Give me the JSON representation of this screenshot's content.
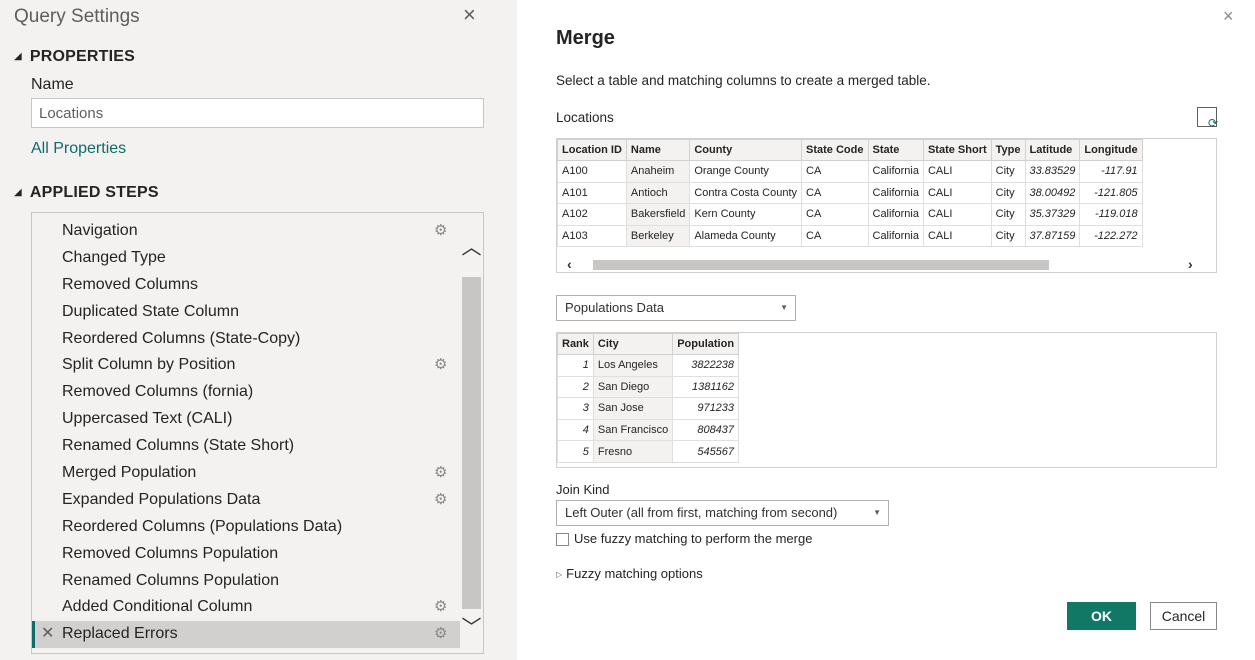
{
  "query_settings": {
    "title": "Query Settings",
    "properties_heading": "PROPERTIES",
    "name_label": "Name",
    "name_value": "Locations",
    "all_properties_link": "All Properties",
    "applied_steps_heading": "APPLIED STEPS",
    "steps": [
      {
        "label": "Navigation",
        "gear": true
      },
      {
        "label": "Changed Type",
        "gear": false
      },
      {
        "label": "Removed Columns",
        "gear": false
      },
      {
        "label": "Duplicated State Column",
        "gear": false
      },
      {
        "label": "Reordered Columns (State-Copy)",
        "gear": false
      },
      {
        "label": "Split Column by Position",
        "gear": true
      },
      {
        "label": "Removed Columns (fornia)",
        "gear": false
      },
      {
        "label": "Uppercased Text (CALI)",
        "gear": false
      },
      {
        "label": "Renamed Columns (State Short)",
        "gear": false
      },
      {
        "label": "Merged Population",
        "gear": true
      },
      {
        "label": "Expanded Populations Data",
        "gear": true
      },
      {
        "label": "Reordered Columns (Populations Data)",
        "gear": false
      },
      {
        "label": "Removed Columns Population",
        "gear": false
      },
      {
        "label": "Renamed Columns Population",
        "gear": false
      },
      {
        "label": "Added Conditional Column",
        "gear": true
      },
      {
        "label": "Replaced Errors",
        "gear": true,
        "active": true
      }
    ]
  },
  "merge": {
    "title": "Merge",
    "description": "Select a table and matching columns to create a merged table.",
    "table1_name": "Locations",
    "table1": {
      "columns": [
        "Location ID",
        "Name",
        "County",
        "State Code",
        "State",
        "State Short",
        "Type",
        "Latitude",
        "Longitude"
      ],
      "rows": [
        [
          "A100",
          "Anaheim",
          "Orange County",
          "CA",
          "California",
          "CALI",
          "City",
          "33.83529",
          "-117.91"
        ],
        [
          "A101",
          "Antioch",
          "Contra Costa County",
          "CA",
          "California",
          "CALI",
          "City",
          "38.00492",
          "-121.805"
        ],
        [
          "A102",
          "Bakersfield",
          "Kern County",
          "CA",
          "California",
          "CALI",
          "City",
          "35.37329",
          "-119.018"
        ],
        [
          "A103",
          "Berkeley",
          "Alameda County",
          "CA",
          "California",
          "CALI",
          "City",
          "37.87159",
          "-122.272"
        ]
      ]
    },
    "table2_selected": "Populations Data",
    "table2": {
      "columns": [
        "Rank",
        "City",
        "Population"
      ],
      "rows": [
        [
          "1",
          "Los Angeles",
          "3822238"
        ],
        [
          "2",
          "San Diego",
          "1381162"
        ],
        [
          "3",
          "San Jose",
          "971233"
        ],
        [
          "4",
          "San Francisco",
          "808437"
        ],
        [
          "5",
          "Fresno",
          "545567"
        ]
      ]
    },
    "join_kind_label": "Join Kind",
    "join_kind_value": "Left Outer (all from first, matching from second)",
    "fuzzy_checkbox_label": "Use fuzzy matching to perform the merge",
    "fuzzy_checked": false,
    "fuzzy_options_label": "Fuzzy matching options",
    "ok_label": "OK",
    "cancel_label": "Cancel"
  },
  "icons": {
    "close": "×",
    "gear": "⚙",
    "delete": "✕",
    "chevron_up": "︿",
    "chevron_down": "﹀",
    "triangle_down": "◢",
    "caret_down": "▼"
  },
  "colors": {
    "accent": "#117865",
    "link": "#106a6a",
    "panel_bg": "#f3f2f1"
  }
}
